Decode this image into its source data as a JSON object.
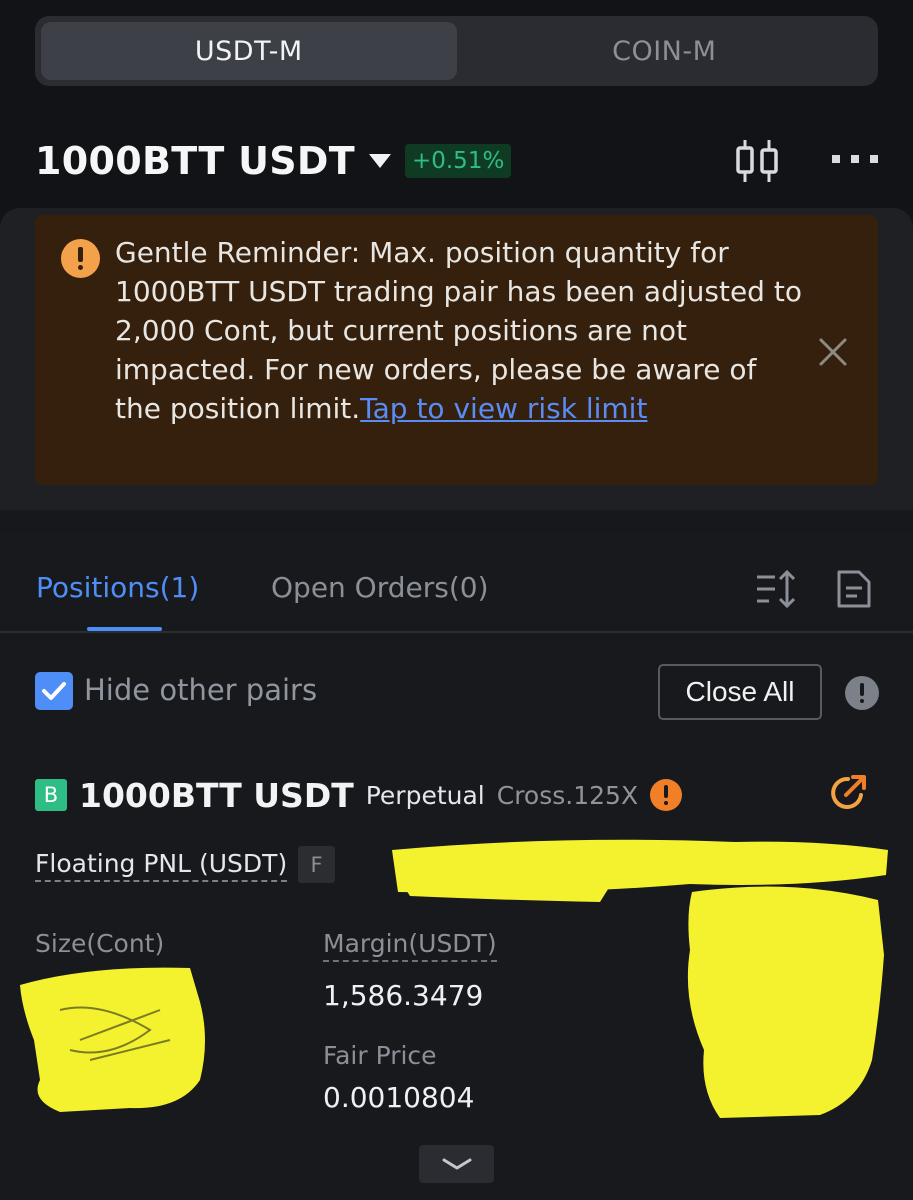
{
  "segment": {
    "tabs": [
      "USDT-M",
      "COIN-M"
    ],
    "active": 0
  },
  "header": {
    "pair": "1000BTT USDT",
    "change": "+0.51%",
    "change_color": "#2ebd85"
  },
  "reminder": {
    "text": "Gentle Reminder: Max. position quantity for 1000BTT USDT trading pair has been adjusted to 2,000 Cont, but current positions are not impacted. For new orders, please be aware of the position limit.",
    "link": "Tap to view risk limit",
    "icon": "warning-icon",
    "bg_color": "#34200c"
  },
  "tabs": {
    "positions": "Positions(1)",
    "open_orders": "Open Orders(0)",
    "active_color": "#4f8ef7"
  },
  "filter": {
    "hide_other_pairs": "Hide other pairs",
    "checked": true,
    "close_all": "Close All"
  },
  "position": {
    "side": "B",
    "pair": "1000BTT USDT",
    "type": "Perpetual",
    "mode": "Cross.125X",
    "pnl_label": "Floating PNL (USDT)",
    "pnl_flag": "F",
    "size_label": "Size(Cont)",
    "margin_label": "Margin(USDT)",
    "margin_value": "1,586.3479",
    "fair_price_label": "Fair Price",
    "fair_price_value": "0.0010804"
  },
  "colors": {
    "redaction": "#f4f22e",
    "buy": "#2ebd85",
    "warning": "#f07f27"
  }
}
